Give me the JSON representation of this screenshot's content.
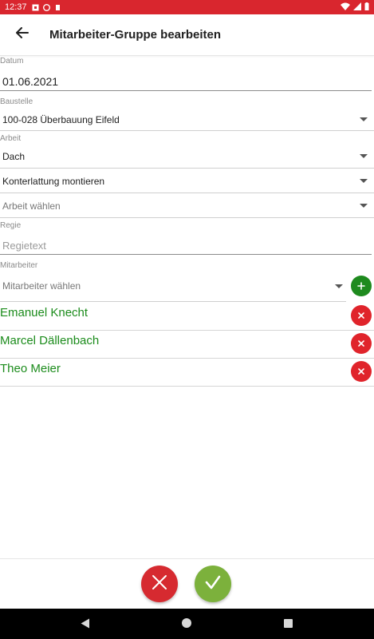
{
  "statusbar": {
    "time": "12:37",
    "bg_color": "#d9262e"
  },
  "appbar": {
    "back_icon": "arrow-left-icon",
    "title": "Mitarbeiter-Gruppe bearbeiten"
  },
  "form": {
    "datum": {
      "label": "Datum",
      "value": "01.06.2021"
    },
    "baustelle": {
      "label": "Baustelle",
      "value": "100-028 Überbauung Eifeld"
    },
    "arbeit": {
      "label": "Arbeit",
      "value1": "Dach",
      "value2": "Konterlattung montieren",
      "placeholder3": "Arbeit wählen"
    },
    "regie": {
      "label": "Regie",
      "placeholder": "Regietext"
    },
    "mitarbeiter": {
      "label": "Mitarbeiter",
      "placeholder": "Mitarbeiter wählen",
      "add_icon": "plus-icon"
    }
  },
  "employees": [
    {
      "name": "Emanuel Knecht"
    },
    {
      "name": "Marcel Dällenbach"
    },
    {
      "name": "Theo Meier"
    }
  ],
  "actions": {
    "cancel_icon": "close-icon",
    "confirm_icon": "checkmark-icon"
  },
  "colors": {
    "accent_red": "#d62a30",
    "accent_green": "#1e8a1e",
    "confirm_green": "#7cb13c",
    "employee_text": "#1c8c1c"
  }
}
